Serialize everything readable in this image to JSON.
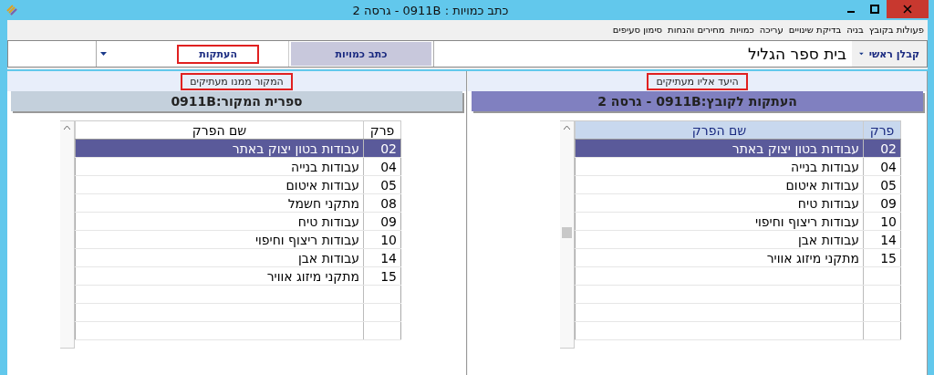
{
  "window": {
    "title": "כתב כמויות : 0911B - גרסה 2"
  },
  "menu": [
    "פעולות בקובץ",
    "בניה",
    "בדיקת שינויים",
    "עריכה",
    "כמויות",
    "מחירים והנחות",
    "סימון סעיפים"
  ],
  "toolbar": {
    "contractor": "קבלן ראשי",
    "project": "בית ספר הגליל",
    "tab_button": "כתב כמויות",
    "copies_field": {
      "value": "העתקות",
      "highlighted": true
    }
  },
  "panels": [
    {
      "caption": "היעד אליו מעתיקים",
      "caption_highlighted": true,
      "heading": "העתקות לקובץ:0911B - גרסה 2",
      "kind": "target",
      "scroll_thumb": true,
      "columns": [
        "פרק",
        "שם הפרק"
      ],
      "rows": [
        {
          "chapter": "02",
          "name": "עבודות בטון יצוק באתר",
          "selected": true
        },
        {
          "chapter": "04",
          "name": "עבודות בנייה",
          "selected": false
        },
        {
          "chapter": "05",
          "name": "עבודות איטום",
          "selected": false
        },
        {
          "chapter": "09",
          "name": "עבודות טיח",
          "selected": false
        },
        {
          "chapter": "10",
          "name": "עבודות ריצוף וחיפוי",
          "selected": false
        },
        {
          "chapter": "14",
          "name": "עבודות אבן",
          "selected": false
        },
        {
          "chapter": "15",
          "name": "מתקני מיזוג אוויר",
          "selected": false
        }
      ]
    },
    {
      "caption": "המקור ממנו מעתיקים",
      "caption_highlighted": true,
      "heading": "ספרית המקור:0911B",
      "kind": "source",
      "scroll_thumb": false,
      "columns": [
        "פרק",
        "שם הפרק"
      ],
      "rows": [
        {
          "chapter": "02",
          "name": "עבודות בטון יצוק באתר",
          "selected": true
        },
        {
          "chapter": "04",
          "name": "עבודות בנייה",
          "selected": false
        },
        {
          "chapter": "05",
          "name": "עבודות איטום",
          "selected": false
        },
        {
          "chapter": "08",
          "name": "מתקני חשמל",
          "selected": false
        },
        {
          "chapter": "09",
          "name": "עבודות טיח",
          "selected": false
        },
        {
          "chapter": "10",
          "name": "עבודות ריצוף וחיפוי",
          "selected": false
        },
        {
          "chapter": "14",
          "name": "עבודות אבן",
          "selected": false
        },
        {
          "chapter": "15",
          "name": "מתקני מיזוג אוויר",
          "selected": false
        }
      ]
    }
  ]
}
